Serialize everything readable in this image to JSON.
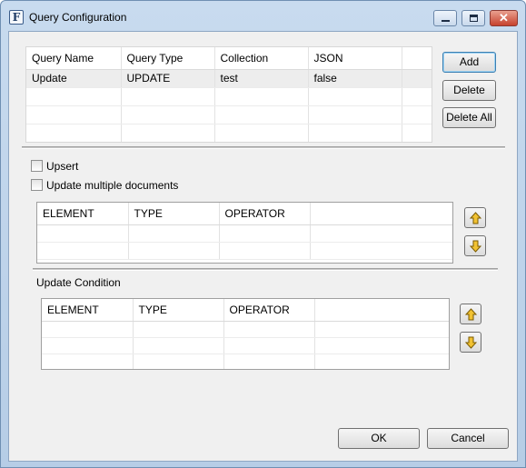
{
  "window": {
    "title": "Query Configuration",
    "icon_letter": "F",
    "icon_name": "app-icon",
    "minimize_icon": "minimize-icon",
    "maximize_icon": "maximize-icon",
    "close_icon": "close-icon",
    "close_glyph": "✕"
  },
  "queries": {
    "columns": [
      "Query Name",
      "Query Type",
      "Collection",
      "JSON"
    ],
    "rows": [
      [
        "Update",
        "UPDATE",
        "test",
        "false"
      ]
    ]
  },
  "actions": {
    "add": "Add",
    "delete": "Delete",
    "delete_all": "Delete All"
  },
  "options": {
    "upsert": {
      "label": "Upsert",
      "checked": false
    },
    "update_multiple": {
      "label": "Update multiple documents",
      "checked": false
    }
  },
  "fields_grid": {
    "columns": [
      "ELEMENT",
      "TYPE",
      "OPERATOR",
      ""
    ]
  },
  "update_condition": {
    "label": "Update Condition",
    "columns": [
      "ELEMENT",
      "TYPE",
      "OPERATOR",
      ""
    ]
  },
  "icons": {
    "up": "arrow-up-icon",
    "down": "arrow-down-icon",
    "accent": "#e8b82a"
  },
  "footer": {
    "ok": "OK",
    "cancel": "Cancel"
  }
}
